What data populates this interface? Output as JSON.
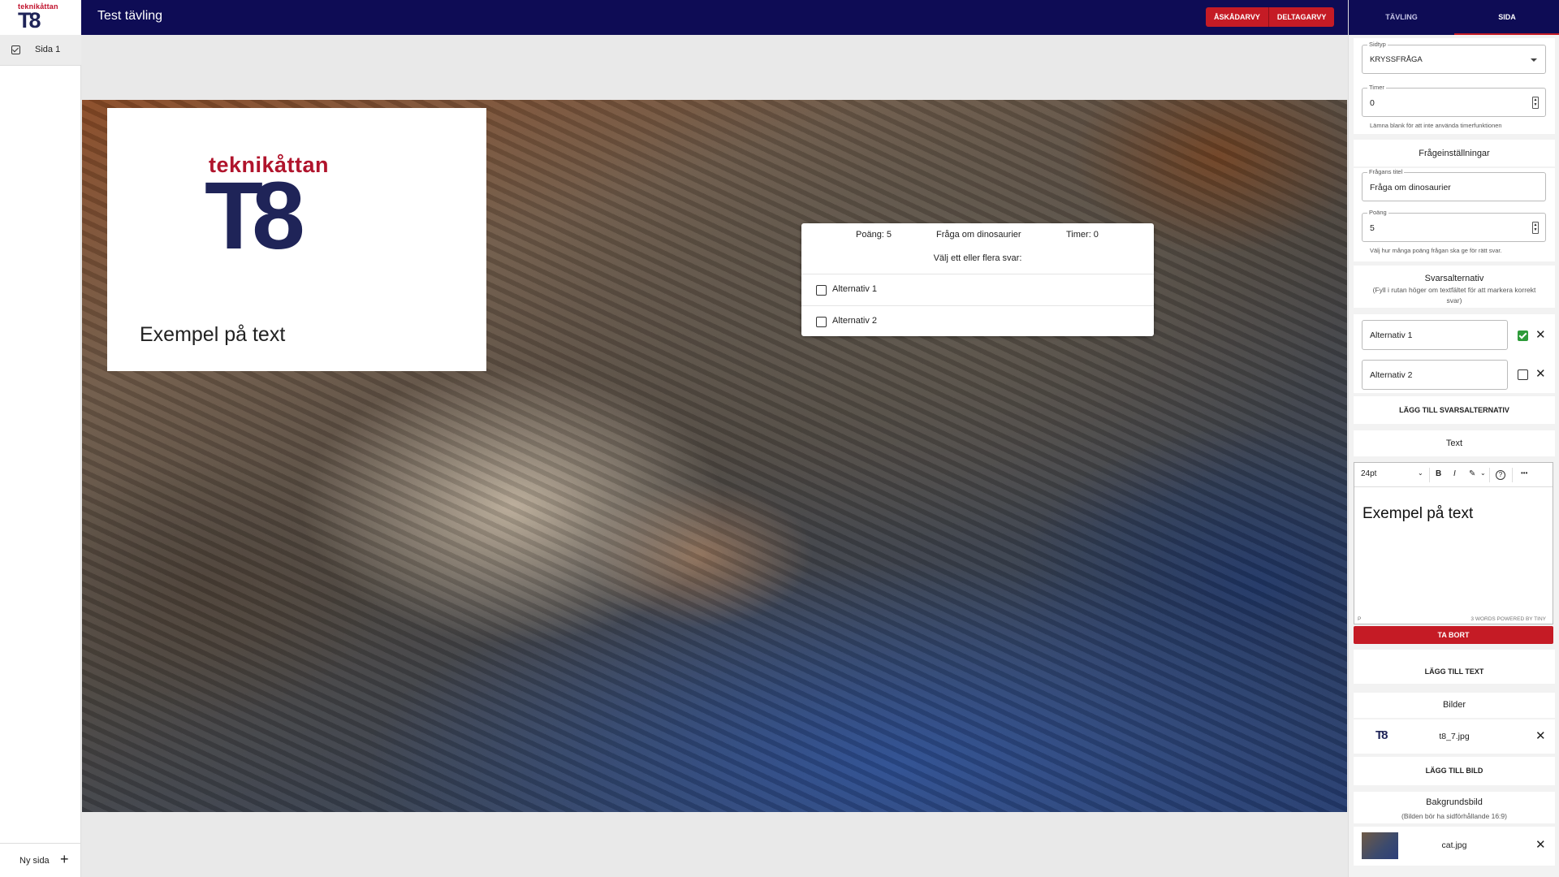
{
  "app": {
    "logo_small": "teknikåttan",
    "logo_big": "T8",
    "title": "Test tävling",
    "view_buttons": [
      "ÅSKÅDARVY",
      "DELTAGARVY"
    ]
  },
  "sidebar": {
    "pages": [
      {
        "label": "Sida 1",
        "checked": true
      }
    ],
    "new_page_label": "Ny sida",
    "new_page_icon": "+"
  },
  "canvas": {
    "background_image": "cat.jpg",
    "text_card": {
      "logo_small": "teknikåttan",
      "logo_big": "T8",
      "text": "Exempel på text"
    },
    "question": {
      "points": "Poäng: 5",
      "title": "Fråga om dinosaurier",
      "timer": "Timer: 0",
      "instruction": "Välj ett eller flera svar:",
      "alternatives": [
        "Alternativ 1",
        "Alternativ 2"
      ]
    }
  },
  "right_panel": {
    "tabs": [
      "TÄVLING",
      "SIDA"
    ],
    "active_tab": "SIDA",
    "page_type": {
      "label": "Sidtyp",
      "value": "KRYSSFRÅGA"
    },
    "timer": {
      "label": "Timer",
      "value": "0",
      "helper": "Lämna blank för att inte använda timerfunktionen"
    },
    "question_settings": {
      "title": "Frågeinställningar",
      "question_title": {
        "label": "Frågans titel",
        "value": "Fråga om dinosaurier"
      },
      "points": {
        "label": "Poäng",
        "value": "5",
        "helper": "Välj hur många poäng frågan ska ge för rätt svar."
      }
    },
    "answers": {
      "title": "Svarsalternativ",
      "subtitle": "(Fyll i rutan höger om textfältet för att markera korrekt svar)",
      "items": [
        {
          "value": "Alternativ 1",
          "correct": true
        },
        {
          "value": "Alternativ 2",
          "correct": false
        }
      ],
      "add_label": "LÄGG TILL SVARSALTERNATIV"
    },
    "text_section": {
      "title": "Text",
      "font_size": "24pt",
      "bold": "B",
      "italic": "I",
      "highlight": "✎",
      "help": "?",
      "more": "•••",
      "content": "Exempel på text",
      "status_left": "P",
      "status_right": "3 WORDS  POWERED BY TINY",
      "delete_label": "TA BORT",
      "add_label": "LÄGG TILL TEXT"
    },
    "images": {
      "title": "Bilder",
      "items": [
        {
          "thumb": "T8",
          "name": "t8_7.jpg"
        }
      ],
      "add_label": "LÄGG TILL BILD"
    },
    "background": {
      "title": "Bakgrundsbild",
      "subtitle": "(Bilden bör ha sidförhållande 16:9)",
      "file": "cat.jpg"
    },
    "close_icon": "✕"
  },
  "colors": {
    "navy": "#0e0c55",
    "red": "#c51b25",
    "green": "#2e9b3a"
  }
}
